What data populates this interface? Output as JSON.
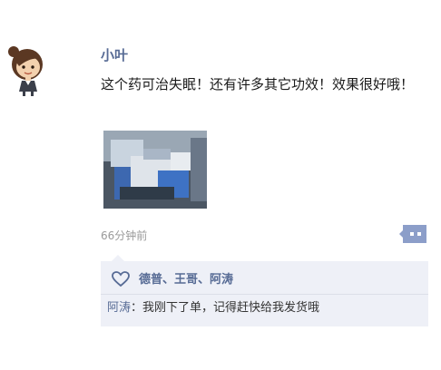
{
  "post": {
    "author": "小叶",
    "text": "这个药可治失眠！还有许多其它功效！效果很好哦！",
    "time": "66分钟前",
    "image": "blurred product photo"
  },
  "interactions": {
    "likers": "德普、王哥、阿涛",
    "comments": [
      {
        "author": "阿涛",
        "separator": "：",
        "text": "我刚下了单，记得赶快给我发货哦"
      }
    ]
  },
  "icons": {
    "avatar": "cartoon-girl-avatar",
    "like": "heart-icon",
    "more": "comment-more-icon"
  },
  "colors": {
    "name_link": "#576b95",
    "interaction_bg": "#eef0f7",
    "time_text": "#9a9a9a",
    "body_text": "#1a1a1a"
  }
}
